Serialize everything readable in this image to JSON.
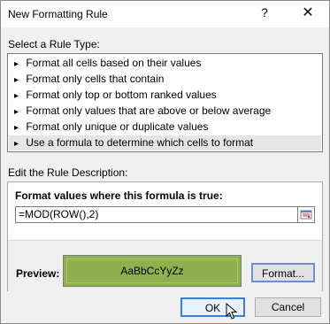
{
  "title": "New Formatting Rule",
  "titlebar": {
    "help": "?",
    "close": "✕"
  },
  "rule_type_label": "Select a Rule Type:",
  "rules": [
    {
      "label": "Format all cells based on their values"
    },
    {
      "label": "Format only cells that contain"
    },
    {
      "label": "Format only top or bottom ranked values"
    },
    {
      "label": "Format only values that are above or below average"
    },
    {
      "label": "Format only unique or duplicate values"
    },
    {
      "label": "Use a formula to determine which cells to format"
    }
  ],
  "selected_rule_index": 5,
  "description_label": "Edit the Rule Description:",
  "description": {
    "formula_title": "Format values where this formula is true:",
    "formula_value": "=MOD(ROW(),2)"
  },
  "preview": {
    "label": "Preview:",
    "sample_text": "AaBbCcYyZz",
    "fill_color": "#8fb04e"
  },
  "format_button": "Format...",
  "ok_button": "OK",
  "cancel_button": "Cancel",
  "arrow_glyph": "▸"
}
